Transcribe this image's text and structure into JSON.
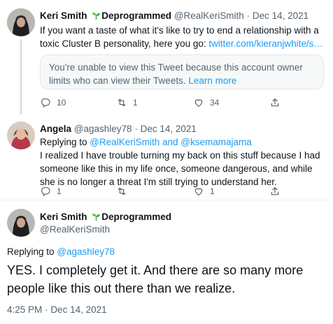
{
  "tweet1": {
    "display_name": "Keri Smith",
    "name_suffix": "Deprogrammed",
    "handle": "@RealKeriSmith",
    "separator": "·",
    "date": "Dec 14, 2021",
    "text": "If you want a taste of what it's like to try to end a relationship with a toxic Cluster B personality, here you go: ",
    "link": "twitter.com/kieranjwhite/s…",
    "notice_text": "You're unable to view this Tweet because this account owner limits who can view their Tweets. ",
    "notice_link": "Learn more",
    "replies": "10",
    "retweets": "1",
    "likes": "34",
    "icons": [
      "reply-icon",
      "retweet-icon",
      "like-icon",
      "share-icon"
    ]
  },
  "tweet2": {
    "display_name": "Angela",
    "handle": "@agashley78",
    "separator": "·",
    "date": "Dec 14, 2021",
    "replying_prefix": "Replying to ",
    "replying_users": "@RealKeriSmith and @ksemamajama",
    "text": "I realized I have trouble turning my back on this stuff because I had someone like this in my life once, someone dangerous, and while she is no longer a threat I'm still trying to understand her.",
    "replies": "1",
    "retweets": "",
    "likes": "1"
  },
  "tweet3": {
    "display_name": "Keri Smith",
    "name_suffix": "Deprogrammed",
    "handle": "@RealKeriSmith",
    "replying_prefix": "Replying to ",
    "replying_user": "@agashley78",
    "text": "YES. I completely get it. And there are so many more people like this out there than we realize.",
    "time": "4:25 PM",
    "separator": "·",
    "date": "Dec 14, 2021"
  },
  "colors": {
    "accent": "#1d9bf0",
    "secondary_text": "#536471",
    "primary_text": "#0f1419",
    "sprout": "#4caf50"
  }
}
